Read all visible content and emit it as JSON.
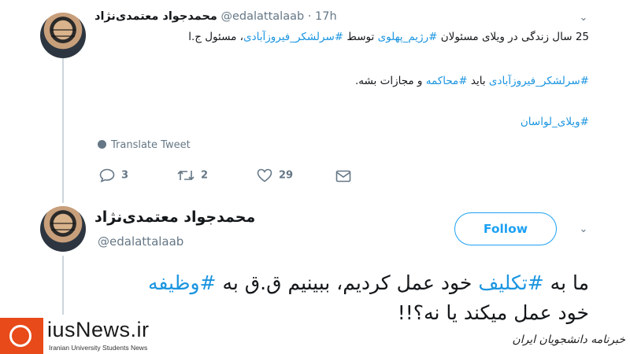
{
  "tweet1": {
    "display_name": "محمدجواد معتمدی‌نژاد",
    "handle": "@edalattalaab",
    "separator": "·",
    "time": "17h",
    "line1": {
      "pre": "25 سال زندگی در ویلای مسئولان ",
      "tag1": "#رژیم_پهلوی",
      "mid": " توسط ",
      "tag2": "#سرلشکر_فیروزآبادی",
      "post": "، مسئول ج.ا"
    },
    "line2": {
      "tag1": "#سرلشکر_فیروزآبادی",
      "mid": " باید ",
      "tag2": "#محاکمه",
      "post": " و مجازات بشه."
    },
    "line3": {
      "tag": "#ویلای_لواسان"
    },
    "translate_label": "Translate Tweet",
    "actions": {
      "replies": "3",
      "retweets": "2",
      "likes": "29"
    }
  },
  "tweet2": {
    "display_name": "محمدجواد معتمدی‌نژاد",
    "handle": "@edalattalaab",
    "follow_label": "Follow",
    "line1": {
      "pre": "ما به ",
      "tag1": "#تکلیف",
      "mid": " خود عمل کردیم، ببینیم ق.ق به ",
      "tag2": "#وظیفه"
    },
    "line2": "خود عمل میکند یا نه؟!!"
  },
  "watermark": {
    "name": "iusNews.ir",
    "subtitle": "Iranian University Students News",
    "persian": "خبرنامه دانشجویان ایران"
  },
  "colors": {
    "link": "#1b95e0",
    "follow": "#1da1f2",
    "muted": "#657786",
    "logo": "#e84a19"
  },
  "icons": [
    "reply-icon",
    "retweet-icon",
    "like-icon",
    "message-icon",
    "globe-icon",
    "chevron-down-icon"
  ]
}
